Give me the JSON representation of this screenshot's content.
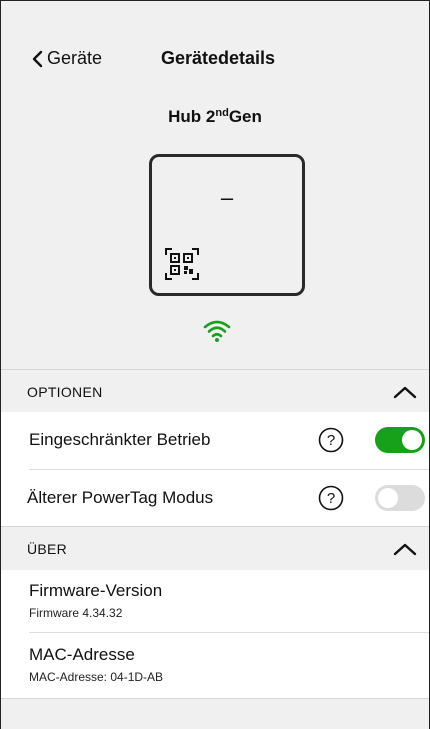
{
  "header": {
    "back_label": "Geräte",
    "title": "Gerätedetails"
  },
  "device": {
    "name_prefix": "Hub 2",
    "name_sup": "nd",
    "name_suffix": "Gen",
    "display_text": "–"
  },
  "options": {
    "header_label": "OPTIONEN",
    "items": [
      {
        "label": "Eingeschränkter Betrieb",
        "enabled": true
      },
      {
        "label": "Älterer PowerTag Modus",
        "enabled": false
      }
    ]
  },
  "about": {
    "header_label": "ÜBER",
    "items": [
      {
        "title": "Firmware-Version",
        "value": "Firmware 4.34.32"
      },
      {
        "title": "MAC-Adresse",
        "value": "MAC-Adresse: 04-1D-AB"
      }
    ]
  },
  "colors": {
    "accent_green": "#17a11a",
    "toggle_off": "#dcdcdc"
  },
  "icons": [
    "chevron-left-icon",
    "qr-code-icon",
    "wifi-icon",
    "chevron-up-icon",
    "help-circle-icon"
  ]
}
